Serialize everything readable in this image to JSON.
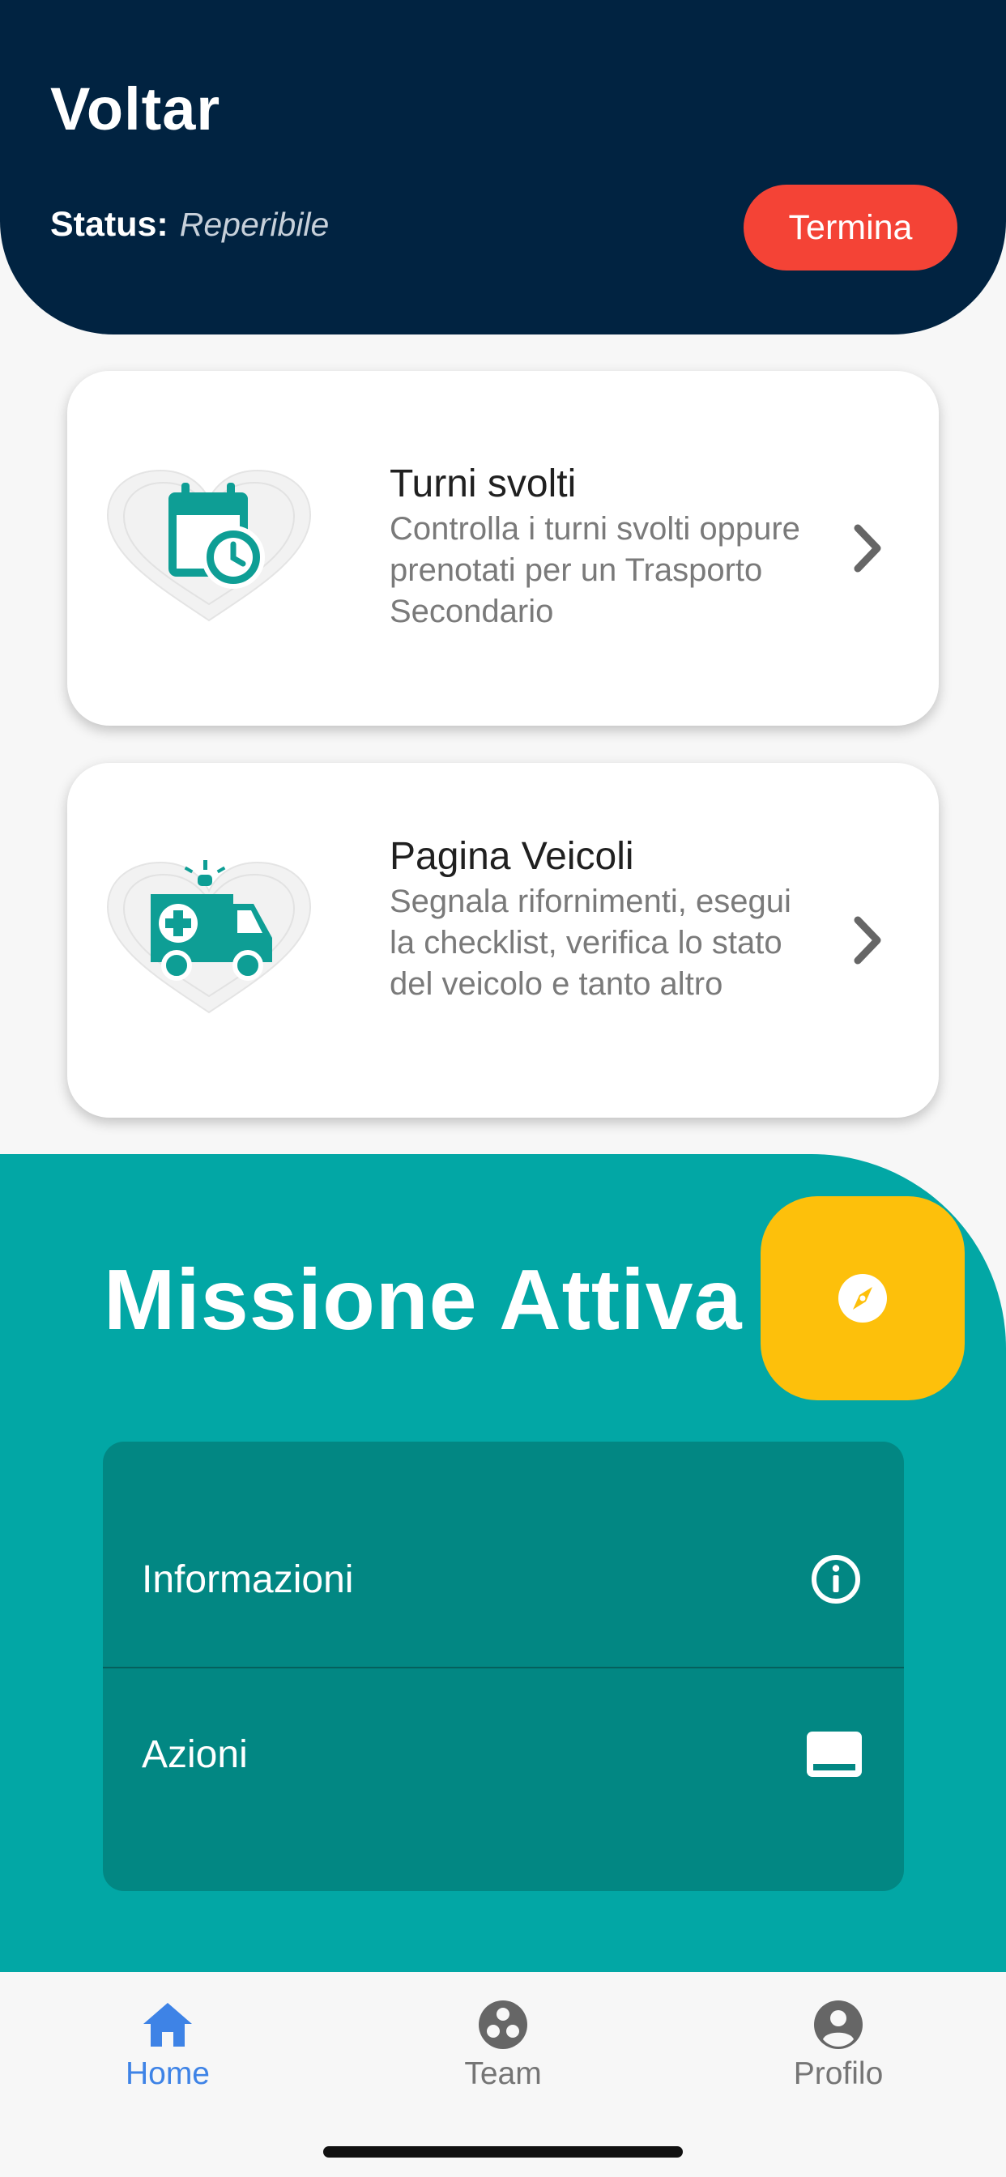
{
  "header": {
    "title": "Voltar",
    "status_label": "Status:",
    "status_value": "Reperibile",
    "end_button_label": "Termina"
  },
  "cards": [
    {
      "title": "Turni svolti",
      "description": "Controlla i turni svolti oppure prenotati per un Trasporto Secondario",
      "icon": "calendar-clock-icon"
    },
    {
      "title": "Pagina Veicoli",
      "description": "Segnala rifornimenti, esegui la checklist, verifica lo stato del veicolo e tanto altro",
      "icon": "ambulance-icon"
    }
  ],
  "mission": {
    "title": "Missione Attiva",
    "fab_icon": "compass-icon",
    "rows": [
      {
        "label": "Informazioni",
        "icon": "info-icon"
      },
      {
        "label": "Azioni",
        "icon": "bottom-sheet-icon"
      }
    ]
  },
  "bottom_nav": {
    "items": [
      {
        "label": "Home",
        "icon": "home-icon",
        "active": true
      },
      {
        "label": "Team",
        "icon": "team-icon",
        "active": false
      },
      {
        "label": "Profilo",
        "icon": "profile-icon",
        "active": false
      }
    ]
  },
  "colors": {
    "header_bg": "#012341",
    "end_button": "#f44336",
    "teal": "#02a7a5",
    "panel": "#028783",
    "fab": "#fdc00b",
    "active_nav": "#3e83e6"
  }
}
